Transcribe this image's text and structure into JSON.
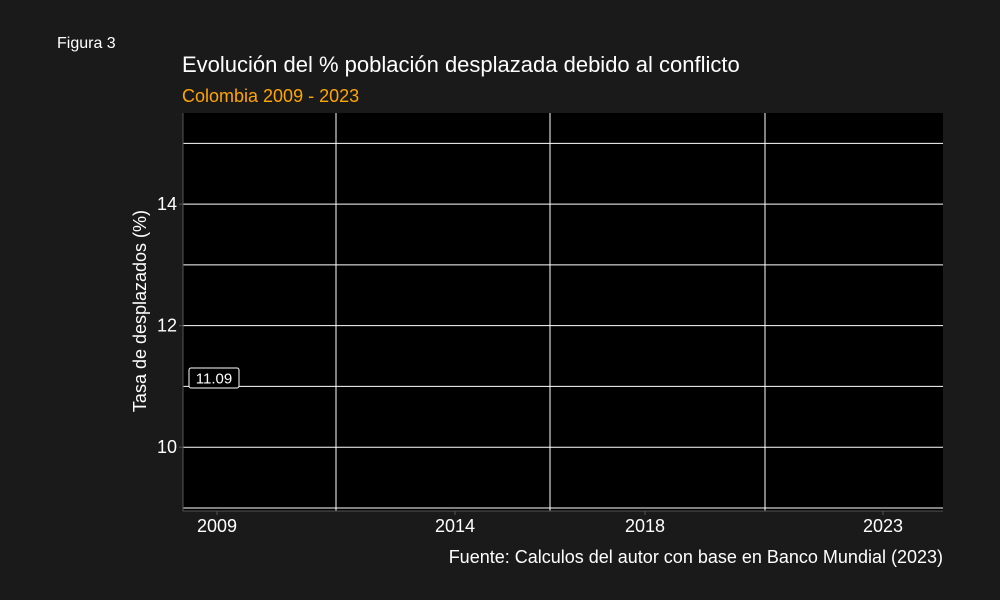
{
  "figure_label": "Figura 3",
  "chart_data": {
    "type": "line",
    "title": "Evolución del % población desplazada debido al conflicto",
    "subtitle": "Colombia 2009 - 2023",
    "xlabel": "",
    "ylabel": "Tasa de desplazados (%)",
    "caption": "Fuente: Calculos del autor con base en Banco Mundial (2023)",
    "x_ticks": [
      "2009",
      "2014",
      "2018",
      "2023"
    ],
    "x_range": [
      2008.4,
      2024.3
    ],
    "y_ticks": [
      10,
      12,
      14
    ],
    "y_minor": [
      9,
      11,
      13,
      15
    ],
    "ylim": [
      8.95,
      15.5
    ],
    "grid": true,
    "points": [
      {
        "x": 2009,
        "y": 11.09,
        "label": "11.09"
      }
    ],
    "colors": {
      "background": "#1a1a1a",
      "panel": "#000000",
      "grid": "#ffffff",
      "text": "#ffffff",
      "subtitle": "#ffa500"
    }
  }
}
